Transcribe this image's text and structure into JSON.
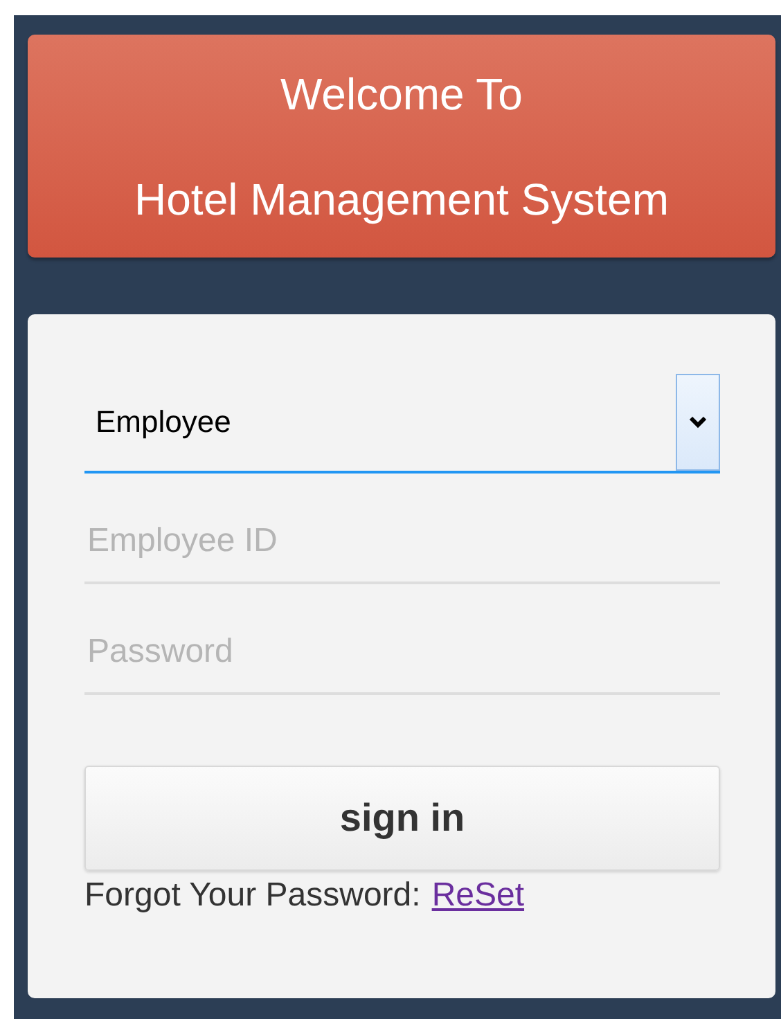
{
  "header": {
    "lines": [
      "Welcome To",
      "Hotel Management System"
    ]
  },
  "form": {
    "role_select": {
      "value": "Employee",
      "focused": true
    },
    "fields": [
      {
        "placeholder": "Employee ID"
      },
      {
        "placeholder": "Password"
      }
    ],
    "submit": "sign in",
    "forgot": {
      "text": "Forgot Your Password:",
      "link": "ReSet"
    }
  }
}
